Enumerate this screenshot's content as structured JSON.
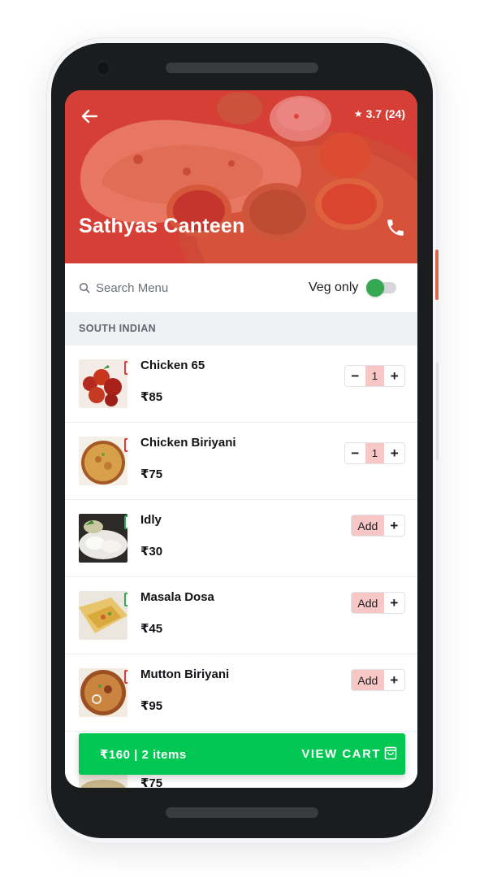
{
  "restaurant": {
    "name": "Sathyas Canteen",
    "rating": "3.7",
    "rating_count": "(24)",
    "star_glyph": "★",
    "back_icon": "arrow-left-icon",
    "call_icon": "phone-icon"
  },
  "search": {
    "placeholder": "Search Menu",
    "icon": "search-icon"
  },
  "filter": {
    "veg_only_label": "Veg only",
    "veg_only_enabled": true
  },
  "section": {
    "title": "SOUTH INDIAN"
  },
  "items": [
    {
      "name": "Chicken 65",
      "price": "₹85",
      "diet": "non-veg",
      "control": "stepper",
      "qty": "1",
      "minus": "−",
      "plus": "+"
    },
    {
      "name": "Chicken Biriyani",
      "price": "₹75",
      "diet": "non-veg",
      "control": "stepper",
      "qty": "1",
      "minus": "−",
      "plus": "+"
    },
    {
      "name": "Idly",
      "price": "₹30",
      "diet": "veg",
      "control": "add",
      "add_label": "Add",
      "plus": "+"
    },
    {
      "name": "Masala Dosa",
      "price": "₹45",
      "diet": "veg",
      "control": "add",
      "add_label": "Add",
      "plus": "+"
    },
    {
      "name": "Mutton Biriyani",
      "price": "₹95",
      "diet": "non-veg",
      "control": "add",
      "add_label": "Add",
      "plus": "+"
    },
    {
      "name": "",
      "price": "₹75",
      "diet": "veg",
      "control": "hidden"
    }
  ],
  "cart": {
    "summary": "₹160 | 2 items",
    "action_label": "VIEW CART",
    "icon": "shopping-bag-icon"
  },
  "colors": {
    "header_tint": "#de3a34",
    "cart_green": "#00c853",
    "veg_green": "#34a853",
    "nonveg_red": "#e53935",
    "qty_pink": "#f6c7c5"
  }
}
